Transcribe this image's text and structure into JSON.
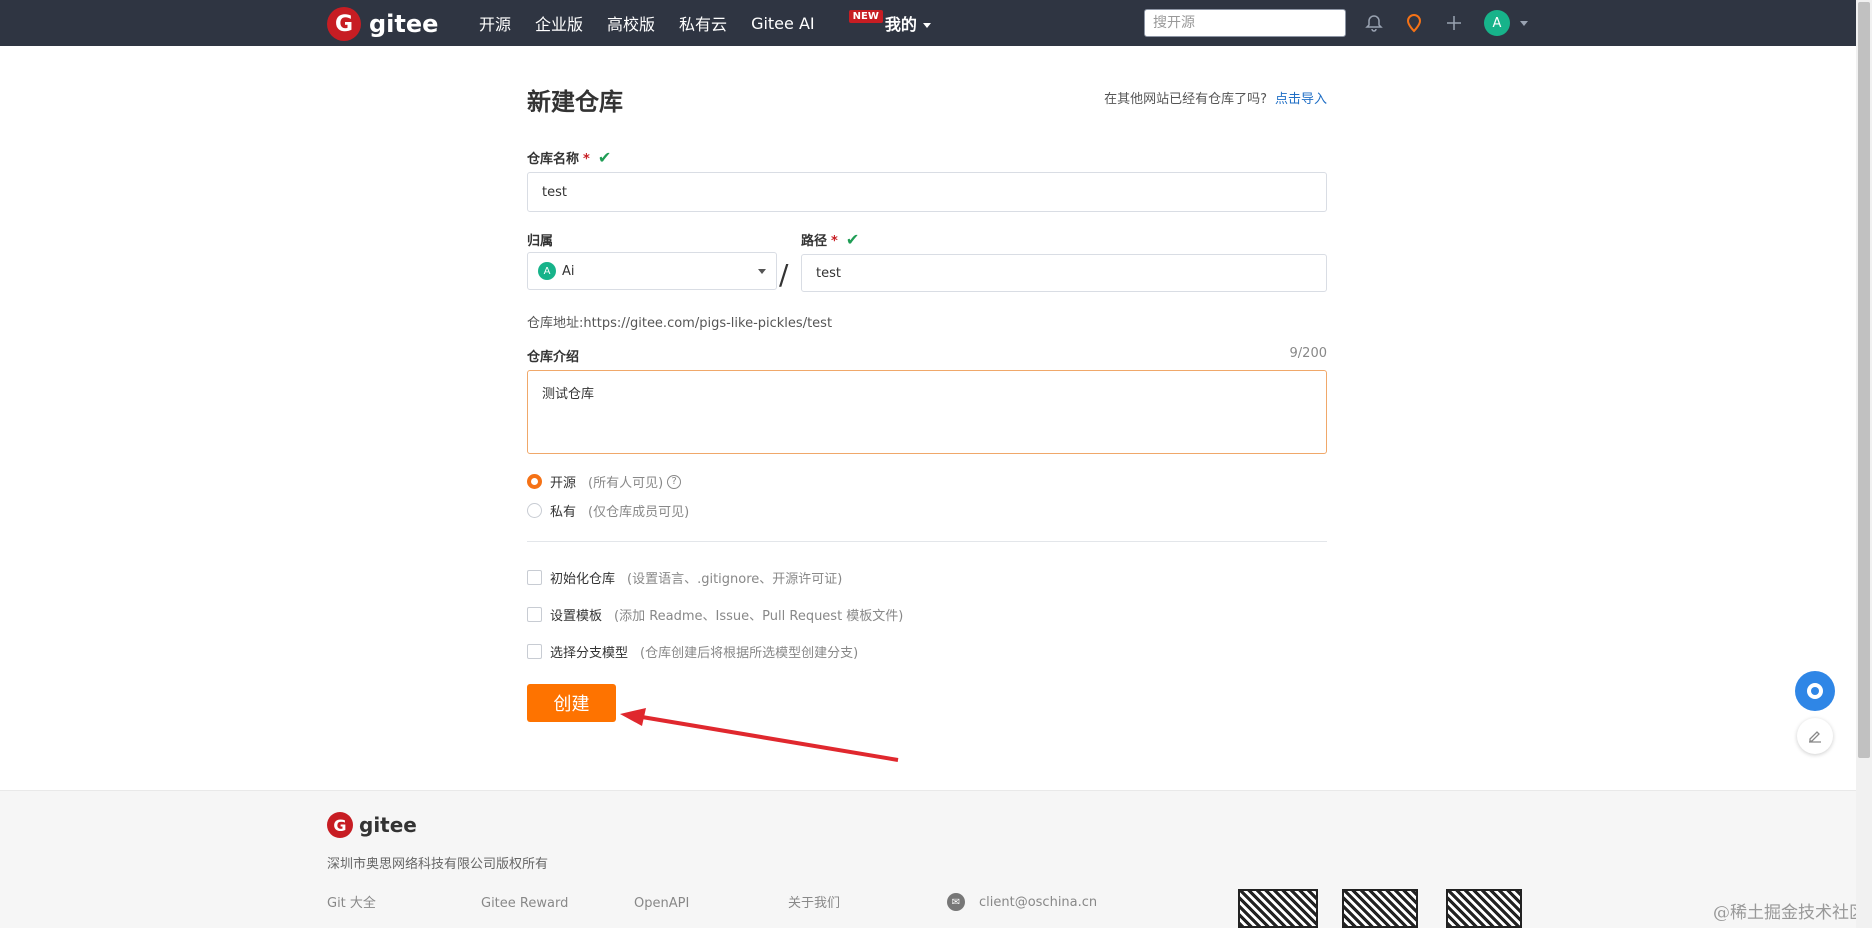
{
  "topbar": {
    "logo_text": "gitee",
    "nav": [
      "开源",
      "企业版",
      "高校版",
      "私有云",
      "Gitee AI"
    ],
    "new_badge": "NEW",
    "mine": "我的",
    "search_placeholder": "搜开源",
    "avatar_letter": "A"
  },
  "form": {
    "title": "新建仓库",
    "import_question": "在其他网站已经有仓库了吗?",
    "import_link": "点击导入",
    "repo_name_label": "仓库名称",
    "required_mark": "*",
    "repo_name_value": "test",
    "owner_label": "归属",
    "owner_avatar": "A",
    "owner_value": "Ai",
    "path_label": "路径",
    "path_value": "test",
    "slash": "/",
    "repo_address": "仓库地址:https://gitee.com/pigs-like-pickles/test",
    "desc_label": "仓库介绍",
    "desc_counter": "9/200",
    "desc_value": "测试仓库",
    "visibility": [
      {
        "label": "开源",
        "hint": "(所有人可见)",
        "selected": true
      },
      {
        "label": "私有",
        "hint": "(仅仓库成员可见)",
        "selected": false
      }
    ],
    "options": [
      {
        "label": "初始化仓库",
        "hint": "(设置语言、.gitignore、开源许可证)"
      },
      {
        "label": "设置模板",
        "hint": "(添加 Readme、Issue、Pull Request 模板文件)"
      },
      {
        "label": "选择分支模型",
        "hint": "(仓库创建后将根据所选模型创建分支)"
      }
    ],
    "create_button": "创建"
  },
  "footer": {
    "logo_text": "gitee",
    "copyright": "深圳市奥思网络科技有限公司版权所有",
    "col1": "Git 大全",
    "col2": "Gitee Reward",
    "col3": "OpenAPI",
    "col4": "关于我们",
    "email": "client@oschina.cn"
  },
  "watermark": "@稀土掘金技术社区",
  "colors": {
    "accent": "#fe7300",
    "brand": "#c71d23",
    "topbar": "#2f3542",
    "link": "#1f6ec5"
  }
}
